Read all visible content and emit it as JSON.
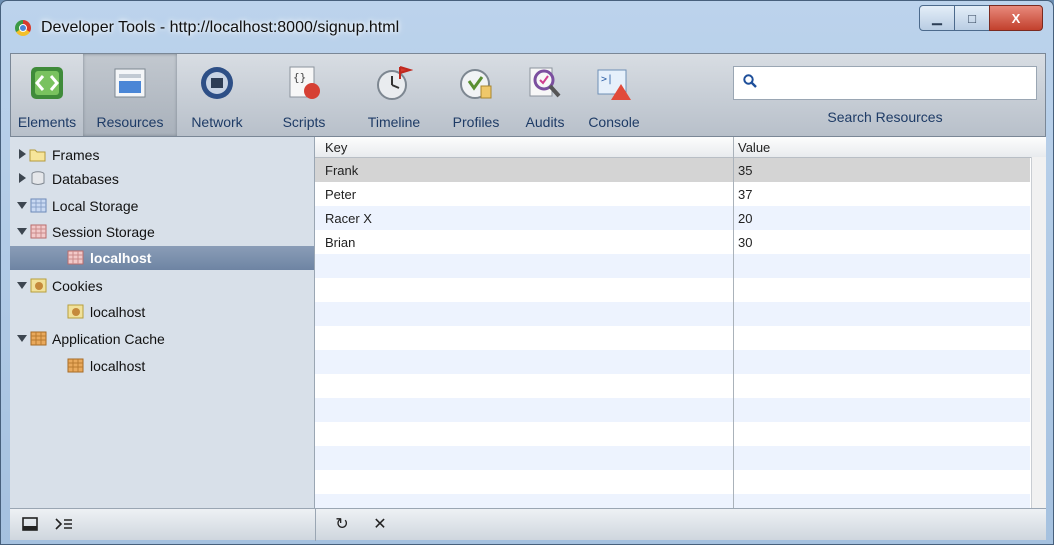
{
  "window": {
    "title": "Developer Tools - http://localhost:8000/signup.html",
    "min_label": "▁",
    "max_label": "□",
    "close_label": "X"
  },
  "toolbar": {
    "tools": [
      {
        "label": "Elements",
        "icon": "elements-icon"
      },
      {
        "label": "Resources",
        "icon": "resources-icon",
        "selected": true
      },
      {
        "label": "Network",
        "icon": "network-icon"
      },
      {
        "label": "Scripts",
        "icon": "scripts-icon"
      },
      {
        "label": "Timeline",
        "icon": "timeline-icon"
      },
      {
        "label": "Profiles",
        "icon": "profiles-icon"
      },
      {
        "label": "Audits",
        "icon": "audits-icon"
      },
      {
        "label": "Console",
        "icon": "console-icon"
      }
    ],
    "search": {
      "value": "",
      "label": "Search Resources"
    }
  },
  "sidebar": {
    "items": [
      {
        "label": "Frames",
        "expanded": false
      },
      {
        "label": "Databases",
        "expanded": false
      },
      {
        "label": "Local Storage",
        "expanded": true
      },
      {
        "label": "Session Storage",
        "expanded": true
      },
      {
        "label": "localhost",
        "selected": true
      },
      {
        "label": "Cookies",
        "expanded": true
      },
      {
        "label": "localhost"
      },
      {
        "label": "Application Cache",
        "expanded": true
      },
      {
        "label": "localhost"
      }
    ]
  },
  "grid": {
    "headers": [
      "Key",
      "Value"
    ],
    "rows": [
      {
        "key": "Frank",
        "value": "35"
      },
      {
        "key": "Peter",
        "value": "37"
      },
      {
        "key": "Racer X",
        "value": "20"
      },
      {
        "key": "Brian",
        "value": "30"
      }
    ]
  },
  "statusbar": {
    "dock_icon": "dock-icon",
    "console_icon": "console-toggle-icon",
    "refresh_label": "↻",
    "delete_label": "✕"
  },
  "colors": {
    "selected_row": "#d4d4d4",
    "stripe": "#edf3fe",
    "accent": "#1e3b66"
  }
}
